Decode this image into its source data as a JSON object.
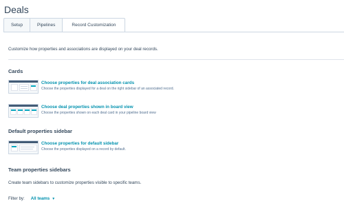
{
  "page": {
    "title": "Deals"
  },
  "tabs": [
    {
      "label": "Setup"
    },
    {
      "label": "Pipelines"
    },
    {
      "label": "Record Customization",
      "active": true
    }
  ],
  "intro": "Customize how properties and associations are displayed on your deal records.",
  "sections": {
    "cards": {
      "title": "Cards",
      "items": [
        {
          "link": "Choose properties for deal association cards",
          "description": "Choose the properties displayed for a deal on the right sidebar of an associated record."
        },
        {
          "link": "Choose deal properties shown in board view",
          "description": "Choose the properties shown on each deal card in your pipeline board view"
        }
      ]
    },
    "default_sidebar": {
      "title": "Default properties sidebar",
      "items": [
        {
          "link": "Choose properties for default sidebar",
          "description": "Choose the properties displayed on a record by default."
        }
      ]
    },
    "team_sidebars": {
      "title": "Team properties sidebars",
      "description": "Create team sidebars to customize properties visible to specific teams."
    }
  },
  "filter": {
    "label": "Filter by:",
    "value": "All teams",
    "icon": "caret-down-icon"
  },
  "colors": {
    "accent": "#0091ae",
    "text": "#33475b",
    "border": "#cbd6e2",
    "thumb_bar": "#425b76"
  }
}
